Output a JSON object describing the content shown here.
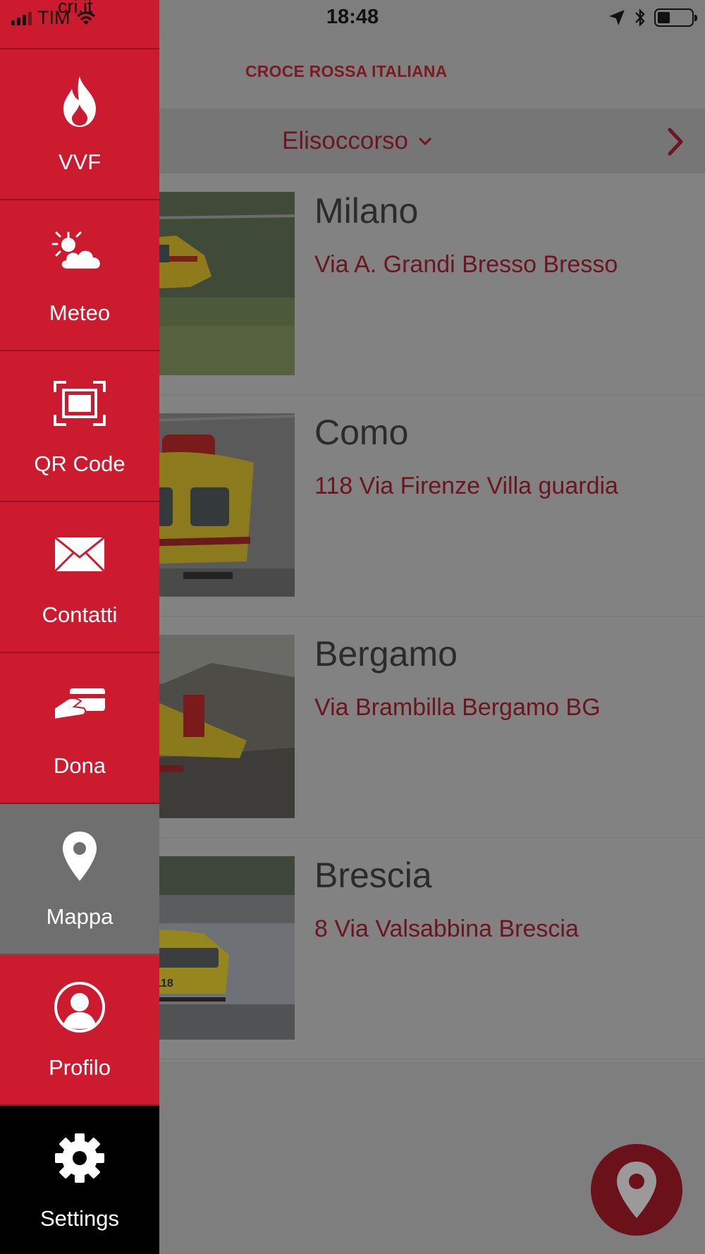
{
  "status_bar": {
    "carrier": "TIM",
    "url": "cri.it",
    "time": "18:48"
  },
  "header": {
    "brand": "CROCE ROSSA ITALIANA"
  },
  "filter": {
    "selected": "Elisoccorso"
  },
  "bases": [
    {
      "city": "Milano",
      "address": "Via A. Grandi Bresso Bresso"
    },
    {
      "city": "Como",
      "address": "118 Via Firenze Villa guardia"
    },
    {
      "city": "Bergamo",
      "address": "Via Brambilla Bergamo BG"
    },
    {
      "city": "Brescia",
      "address": "8 Via Valsabbina Brescia"
    }
  ],
  "drawer": {
    "items": [
      {
        "label": "VVF",
        "icon": "flame-icon"
      },
      {
        "label": "Meteo",
        "icon": "weather-icon"
      },
      {
        "label": "QR Code",
        "icon": "qr-scan-icon"
      },
      {
        "label": "Contatti",
        "icon": "envelope-icon"
      },
      {
        "label": "Dona",
        "icon": "donate-card-icon"
      },
      {
        "label": "Mappa",
        "icon": "map-pin-icon",
        "active": true
      },
      {
        "label": "Profilo",
        "icon": "profile-icon"
      },
      {
        "label": "Settings",
        "icon": "gear-icon"
      }
    ]
  },
  "colors": {
    "drawer_red": "#cc1a2e",
    "active_gray": "#6f6f6f",
    "settings_black": "#000000",
    "dim_overlay": "#7e7e7e",
    "accent_dark_red": "#6b111a"
  }
}
